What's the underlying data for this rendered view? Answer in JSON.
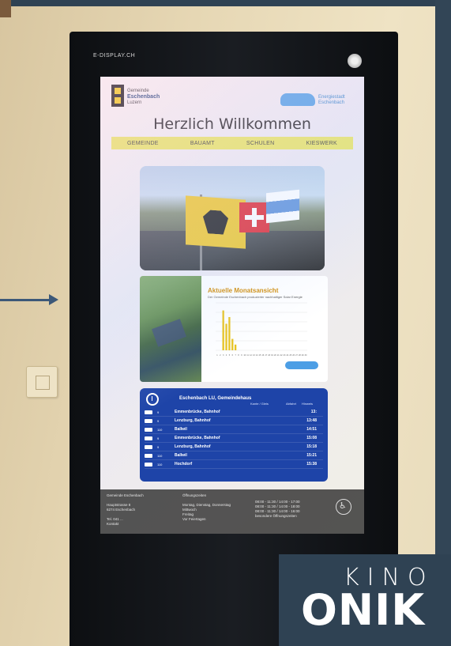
{
  "kiosk": {
    "brand": "E-DISPLAY.CH"
  },
  "screen": {
    "logo_left": {
      "line1": "Gemeinde",
      "name": "Eschenbach",
      "line3": "Luzern"
    },
    "logo_right": {
      "text1": "Energiestadt",
      "text2": "Eschenbach"
    },
    "title": "Herzlich Willkommen",
    "nav": [
      "GEMEINDE",
      "BAUAMT",
      "SCHULEN",
      "KIESWERK"
    ],
    "chart": {
      "title": "Aktuelle Monatsansicht",
      "subtitle": "Der Gemeinde Eschenbach produzierter nachhaltiger Solar Energie"
    },
    "timetable": {
      "title": "Eschenbach LU, Gemeindehaus",
      "headers": [
        "Kante / Gleis",
        "Abfahrt",
        "Hinweis"
      ],
      "rows": [
        {
          "line": "9",
          "dest": "Emmenbrücke, Bahnhof",
          "time": "13:"
        },
        {
          "line": "9",
          "dest": "Lenzburg, Bahnhof",
          "time": "13:48"
        },
        {
          "line": "110",
          "dest": "Ballwil",
          "time": "14:51"
        },
        {
          "line": "9",
          "dest": "Emmenbrücke, Bahnhof",
          "time": "15:08"
        },
        {
          "line": "9",
          "dest": "Lenzburg, Bahnhof",
          "time": "15:18"
        },
        {
          "line": "110",
          "dest": "Ballwil",
          "time": "15:21"
        },
        {
          "line": "110",
          "dest": "Hochdorf",
          "time": "15:38"
        }
      ]
    },
    "footer": {
      "col1": [
        "Gemeinde Eschenbach",
        "",
        "Hauptstrasse 8",
        "6274 Eschenbach",
        "",
        "Tel. 041 ...",
        "Kontakt"
      ],
      "col2": [
        "Öffnungszeiten",
        "",
        "Montag, Dienstag, Donnerstag",
        "Mittwoch",
        "Freitag",
        "Vor Feiertagen"
      ],
      "col3": [
        "08:00 - 11:30 / 14:00 - 17:00",
        "08:00 - 11:30 / 14:00 - 18:00",
        "08:00 - 11:30 / 14:00 - 16:00",
        "besondere Öffnungszeiten"
      ]
    }
  },
  "watermark": {
    "line1": "KINO",
    "line2": "ONIK"
  },
  "chart_data": {
    "type": "bar",
    "title": "Aktuelle Monatsansicht",
    "categories": [
      "1",
      "2",
      "3",
      "4",
      "5",
      "6",
      "7",
      "8",
      "9",
      "10",
      "11",
      "12",
      "13",
      "14",
      "15",
      "16",
      "17",
      "18",
      "19",
      "20",
      "21",
      "22",
      "23",
      "24",
      "25",
      "26",
      "27",
      "28",
      "29",
      "30"
    ],
    "values": [
      0,
      0,
      420,
      280,
      350,
      120,
      60,
      0,
      0,
      0,
      0,
      0,
      0,
      0,
      0,
      0,
      0,
      0,
      0,
      0,
      0,
      0,
      0,
      0,
      0,
      0,
      0,
      0,
      0,
      0
    ],
    "ylim": [
      0,
      500
    ]
  }
}
